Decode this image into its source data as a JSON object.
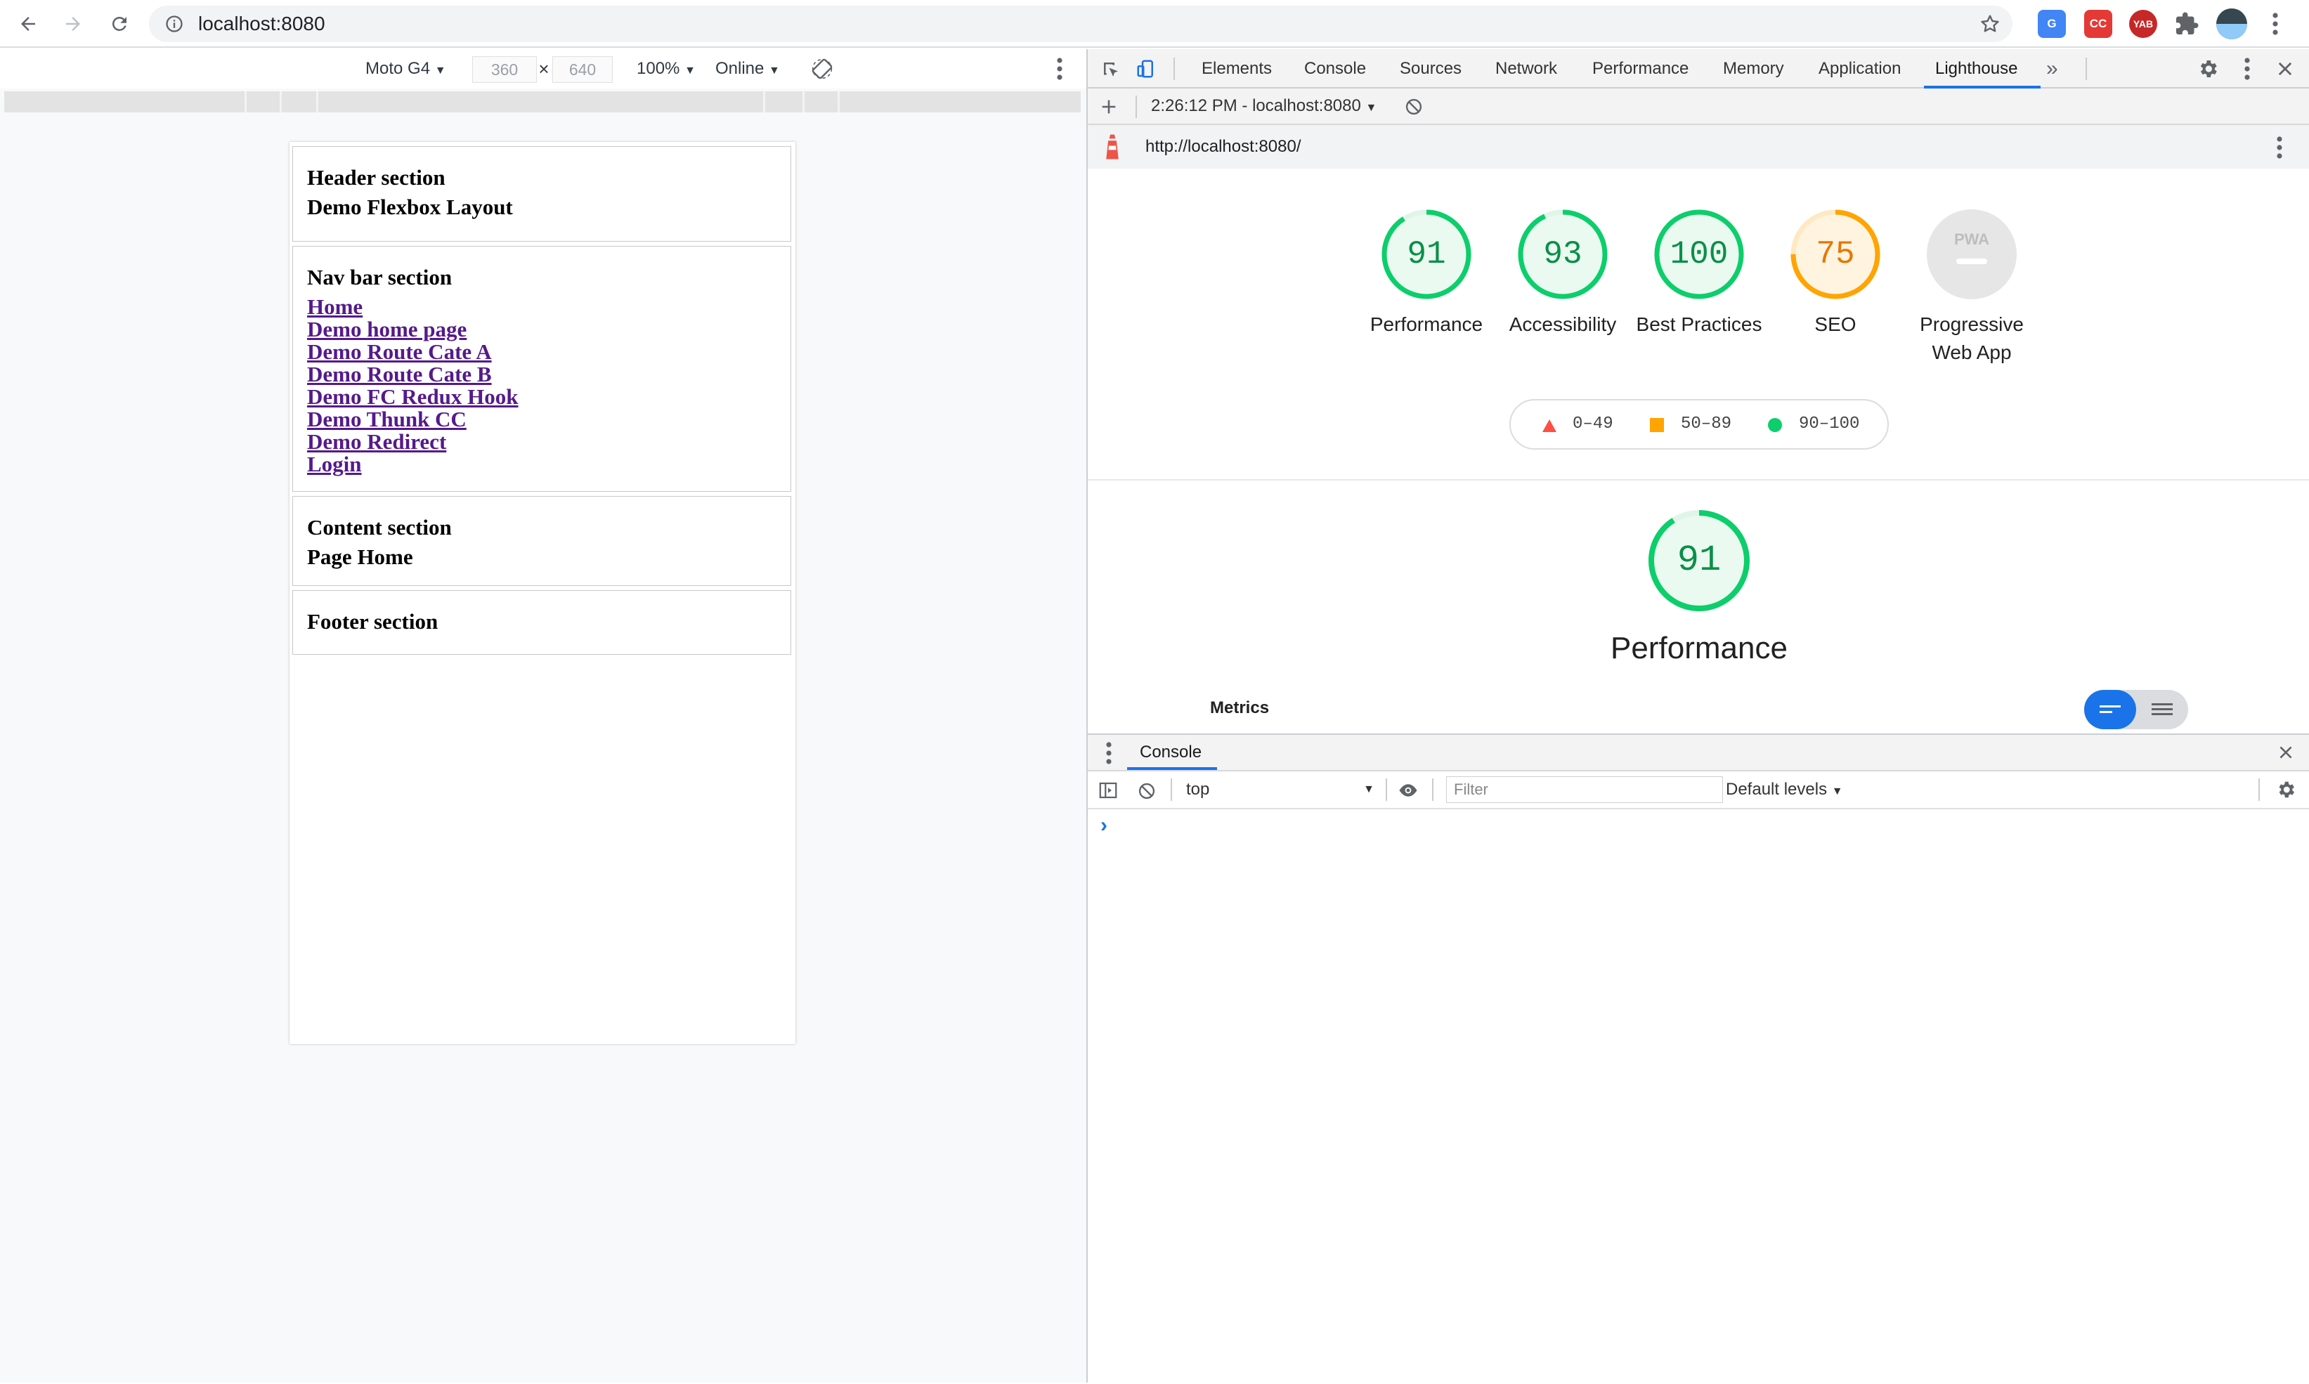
{
  "browser": {
    "url": "localhost:8080",
    "extensions": [
      "translate-icon",
      "cc-icon",
      "yab-icon"
    ],
    "ext_labels": {
      "cc": "CC",
      "yab": "YAB"
    }
  },
  "device_toolbar": {
    "device": "Moto G4",
    "width": "360",
    "height": "640",
    "times": "×",
    "zoom": "100%",
    "network": "Online"
  },
  "page": {
    "header": {
      "title": "Header section",
      "subtitle": "Demo Flexbox Layout"
    },
    "nav": {
      "title": "Nav bar section",
      "links": [
        "Home",
        "Demo home page",
        "Demo Route Cate A",
        "Demo Route Cate B",
        "Demo FC Redux Hook",
        "Demo Thunk CC",
        "Demo Redirect",
        "Login"
      ]
    },
    "content": {
      "title": "Content section",
      "subtitle": "Page Home"
    },
    "footer": {
      "title": "Footer section"
    }
  },
  "devtools": {
    "tabs": [
      "Elements",
      "Console",
      "Sources",
      "Network",
      "Performance",
      "Memory",
      "Application",
      "Lighthouse"
    ],
    "active_tab": "Lighthouse",
    "more_tabs": "»",
    "report_select": "2:26:12 PM - localhost:8080",
    "report_url": "http://localhost:8080/"
  },
  "lighthouse": {
    "scores": [
      {
        "label": "Performance",
        "value": 91,
        "color": "#0cce6b"
      },
      {
        "label": "Accessibility",
        "value": 93,
        "color": "#0cce6b"
      },
      {
        "label": "Best Practices",
        "value": 100,
        "color": "#0cce6b"
      },
      {
        "label": "SEO",
        "value": 75,
        "color": "#ffa400"
      }
    ],
    "pwa": {
      "label": "Progressive Web App",
      "badge": "PWA"
    },
    "legend": [
      {
        "range": "0–49",
        "color": "#ff4e42"
      },
      {
        "range": "50–89",
        "color": "#ffa400"
      },
      {
        "range": "90–100",
        "color": "#0cce6b"
      }
    ],
    "section": {
      "title": "Performance",
      "score": 91,
      "metrics_label": "Metrics"
    }
  },
  "console": {
    "tab_label": "Console",
    "context": "top",
    "filter_placeholder": "Filter",
    "levels": "Default levels",
    "prompt": "›"
  }
}
